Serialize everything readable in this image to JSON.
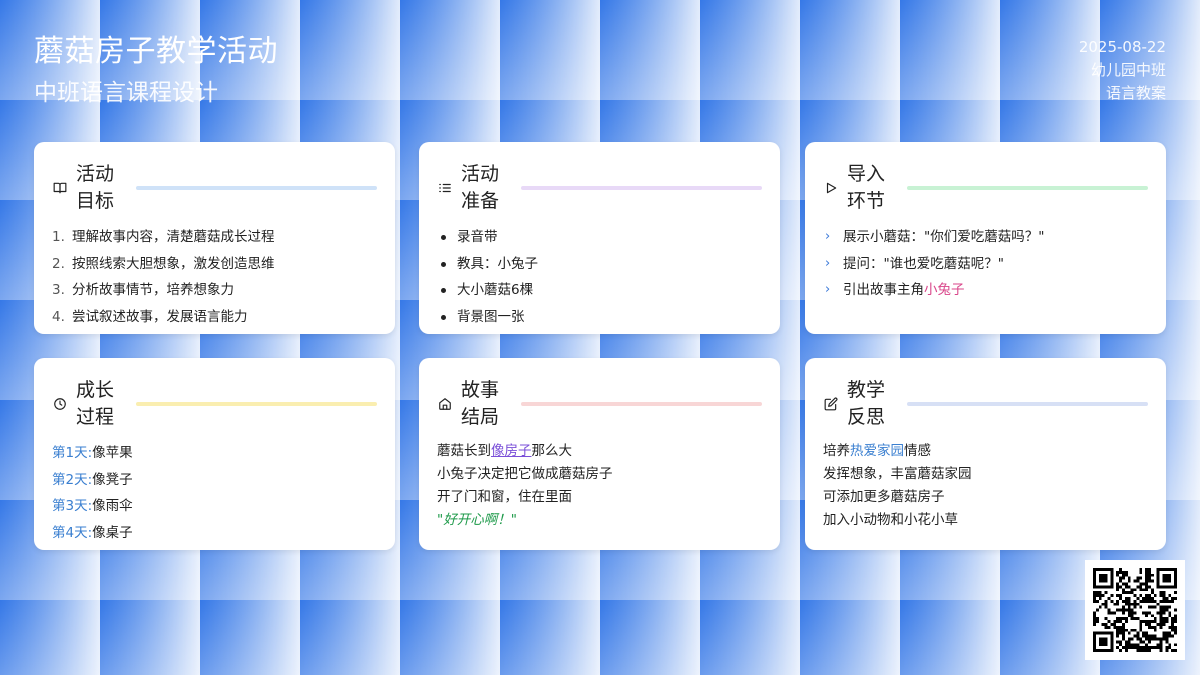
{
  "header": {
    "title": "蘑菇房子教学活动",
    "subtitle": "中班语言课程设计"
  },
  "meta": {
    "date": "2025-08-22",
    "class": "幼儿园中班",
    "type": "语言教案"
  },
  "cards": {
    "goals": {
      "title": "活动目标",
      "icon": "book-icon",
      "line_color": "#cfe2f8",
      "items": [
        {
          "num": "1.",
          "text": "理解故事内容，清楚蘑菇成长过程"
        },
        {
          "num": "2.",
          "text": "按照线索大胆想象，激发创造思维"
        },
        {
          "num": "3.",
          "text": "分析故事情节，培养想象力"
        },
        {
          "num": "4.",
          "text": "尝试叙述故事，发展语言能力"
        }
      ]
    },
    "prep": {
      "title": "活动准备",
      "icon": "list-icon",
      "line_color": "#e8d9f7",
      "items": [
        "录音带",
        "教具：小兔子",
        "大小蘑菇6棵",
        "背景图一张"
      ]
    },
    "intro": {
      "title": "导入环节",
      "icon": "play-icon",
      "line_color": "#c8f2d4",
      "items": [
        {
          "text": "展示小蘑菇：\"你们爱吃蘑菇吗？\"",
          "highlight": ""
        },
        {
          "text": "提问：\"谁也爱吃蘑菇呢？\"",
          "highlight": ""
        },
        {
          "text": "引出故事主角",
          "highlight": "小兔子"
        }
      ]
    },
    "growth": {
      "title": "成长过程",
      "icon": "clock-icon",
      "line_color": "#faeeb0",
      "items": [
        {
          "day": "第1天:",
          "text": "像苹果"
        },
        {
          "day": "第2天:",
          "text": "像凳子"
        },
        {
          "day": "第3天:",
          "text": "像雨伞"
        },
        {
          "day": "第4天:",
          "text": "像桌子"
        }
      ]
    },
    "ending": {
      "title": "故事结局",
      "icon": "home-icon",
      "line_color": "#f8d6d6",
      "line1_pre": "蘑菇长到",
      "line1_link": "像房子",
      "line1_post": "那么大",
      "line2": "小兔子决定把它做成蘑菇房子",
      "line3": "开了门和窗，住在里面",
      "quote": "\"好开心啊！\""
    },
    "reflect": {
      "title": "教学反思",
      "icon": "edit-icon",
      "line_color": "#d7e0f5",
      "line1_pre": "培养",
      "line1_highlight": "热爱家园",
      "line1_post": "情感",
      "line2": "发挥想象，丰富蘑菇家园",
      "line3": "可添加更多蘑菇房子",
      "line4": "加入小动物和小花小草"
    }
  },
  "qr": {
    "icon": "qr-code-icon"
  }
}
